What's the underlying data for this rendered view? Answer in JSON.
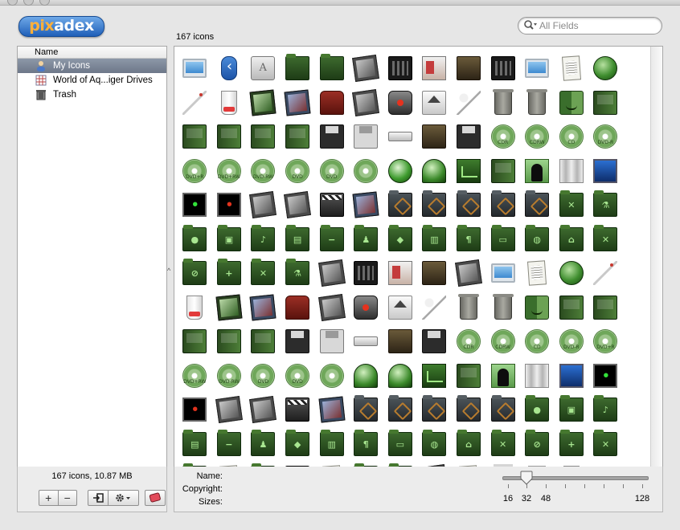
{
  "app": {
    "logo_text": "pixadex",
    "logo_prefix": "pix",
    "logo_suffix": "adex",
    "accent": "#1f5fb8"
  },
  "search": {
    "placeholder": "All Fields"
  },
  "main": {
    "icon_count_label": "167 icons"
  },
  "sidebar": {
    "header": "Name",
    "items": [
      {
        "label": "My Icons",
        "selected": true,
        "icon": "my-icons-icon"
      },
      {
        "label": "World of Aq...iger Drives",
        "selected": false,
        "icon": "calendar-grid-icon"
      },
      {
        "label": "Trash",
        "selected": false,
        "icon": "trash-icon"
      }
    ]
  },
  "footer_left": {
    "stats": "167 icons, 10.87 MB",
    "add_label": "+",
    "remove_label": "−"
  },
  "info": {
    "name_label": "Name:",
    "copyright_label": "Copyright:",
    "sizes_label": "Sizes:"
  },
  "slider": {
    "value": 32,
    "labels": [
      "16",
      "32",
      "48",
      "128"
    ]
  },
  "icons": [
    "monitor",
    "bt",
    "case",
    "f-green",
    "f-green",
    "photos",
    "film",
    "mag",
    "zip",
    "film",
    "monitor",
    "doc",
    "globe",
    "pen",
    "cup",
    "photos-g",
    "photos-c",
    "chair",
    "photos",
    "ghost",
    "eject",
    "spoon",
    "trash",
    "trash",
    "finder",
    "book-g",
    "book-g",
    "book-g",
    "book-g",
    "book-g",
    "floppy",
    "floppy-l",
    "drive",
    "zip",
    "floppy",
    "disc:CDR",
    "disc:CDRW",
    "disc:CD",
    "disc:DVD-R",
    "disc:DVD+R",
    "disc:DVD+RW",
    "disc:DVD-RW",
    "disc:DVD",
    "disc:DVD",
    "disc:",
    "globe-b",
    "bell",
    "chart-g",
    "book-g",
    "person",
    "curtain",
    "screen-b",
    "sign-g",
    "sign-r",
    "photos",
    "photos",
    "clap",
    "photos-c",
    "f-dark",
    "f-dark",
    "f-dark",
    "f-dark",
    "f-dark",
    "f-green",
    "f-green",
    "f-green",
    "f-green",
    "f-green",
    "f-green",
    "f-green",
    "f-green",
    "f-green",
    "f-green",
    "f-green",
    "f-green",
    "f-green",
    "f-green",
    "f-green",
    "f-green",
    "f-green",
    "f-green",
    "f-green",
    "photos",
    "film",
    "mag",
    "zip",
    "photos",
    "monitor",
    "doc",
    "globe",
    "pen",
    "cup",
    "photos-g",
    "photos-c",
    "chair",
    "photos",
    "ghost",
    "eject",
    "spoon",
    "trash",
    "trash",
    "finder",
    "book-g",
    "book-g",
    "book-g",
    "book-g",
    "book-g",
    "floppy",
    "floppy-l",
    "drive",
    "zip",
    "floppy",
    "disc:CDR",
    "disc:CDRW",
    "disc:CD",
    "disc:DVD-R",
    "disc:DVD+R",
    "disc:DVD+RW",
    "disc:DVD-RW",
    "disc:DVD",
    "disc:DVD",
    "disc:",
    "bell",
    "bell",
    "chart-g",
    "book-g",
    "person",
    "curtain",
    "screen-b",
    "sign-g",
    "sign-r",
    "photos",
    "photos",
    "clap",
    "photos-c",
    "f-dark",
    "f-dark",
    "f-dark",
    "f-dark",
    "f-dark",
    "f-green",
    "f-green",
    "f-green",
    "f-green",
    "f-green",
    "f-green",
    "f-green",
    "f-green",
    "f-green",
    "f-green",
    "f-green",
    "f-green",
    "f-green",
    "f-green",
    "f-green",
    "f-green",
    "f-green",
    "doc",
    "f-green",
    "film",
    "doc",
    "f-green",
    "f-green",
    "photos",
    "doc",
    "bucket",
    "glass",
    "cup"
  ]
}
